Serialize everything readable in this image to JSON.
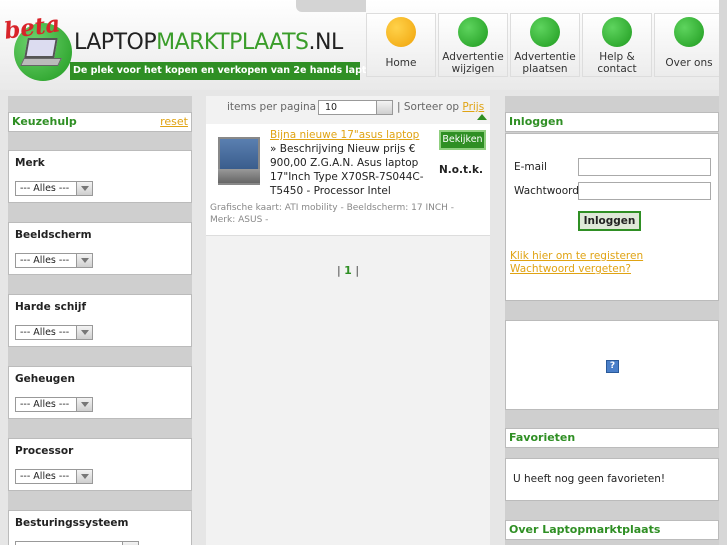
{
  "header": {
    "beta": "beta",
    "brand_part1": "LAPTOP",
    "brand_part2": "MARKTPLAATS",
    "brand_part3": ".NL",
    "tagline": "De plek voor het kopen en verkopen van 2e hands laptops"
  },
  "nav": [
    {
      "label": "Home",
      "color": "orange"
    },
    {
      "label": "Advertentie wijzigen",
      "color": "green"
    },
    {
      "label": "Advertentie plaatsen",
      "color": "green"
    },
    {
      "label": "Help & contact",
      "color": "green"
    },
    {
      "label": "Over ons",
      "color": "green"
    }
  ],
  "keuzehulp": {
    "title": "Keuzehulp",
    "reset": "reset",
    "filters": [
      {
        "label": "Merk",
        "value": "--- Alles ---"
      },
      {
        "label": "Beeldscherm",
        "value": "--- Alles ---"
      },
      {
        "label": "Harde schijf",
        "value": "--- Alles ---"
      },
      {
        "label": "Geheugen",
        "value": "--- Alles ---"
      },
      {
        "label": "Processor",
        "value": "--- Alles ---"
      },
      {
        "label": "Besturingssysteem",
        "value": ""
      }
    ]
  },
  "listing_controls": {
    "items_label": "items per pagina",
    "items_value": "10",
    "separator": "|",
    "sort_label": "Sorteer op",
    "sort_value": "Prijs"
  },
  "listing": {
    "title": "Bijna nieuwe 17\"asus laptop",
    "description": "» Beschrijving Nieuw prijs € 900,00 Z.G.A.N. Asus laptop 17\"Inch Type X70SR-7S044C-T5450 - Processor Intel",
    "meta": "Grafische kaart: ATI mobility - Beeldscherm: 17 INCH - Merk: ASUS -",
    "button": "Bekijken",
    "price": "N.o.t.k."
  },
  "pager": {
    "prefix": "|",
    "page": "1",
    "suffix": "|"
  },
  "login": {
    "title": "Inloggen",
    "email_label": "E-mail",
    "password_label": "Wachtwoord",
    "button": "Inloggen",
    "register_link": "Klik hier om te registeren",
    "forgot_link": "Wachtwoord vergeten?"
  },
  "ad": {
    "icon": "?"
  },
  "favorites": {
    "title": "Favorieten",
    "empty_text": "U heeft nog geen favorieten!"
  },
  "about": {
    "title": "Over Laptopmarktplaats"
  },
  "colors": {
    "accent": "#2f8f24",
    "link": "#e0a313",
    "home": "#f0a30a"
  }
}
